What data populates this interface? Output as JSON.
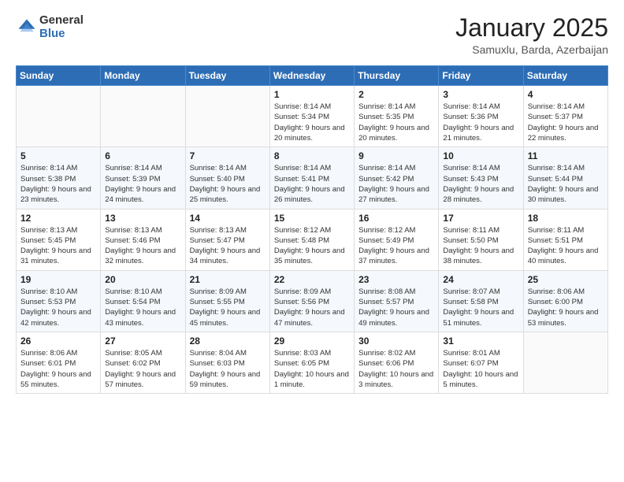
{
  "header": {
    "logo_line1": "General",
    "logo_line2": "Blue",
    "month": "January 2025",
    "location": "Samuxlu, Barda, Azerbaijan"
  },
  "weekdays": [
    "Sunday",
    "Monday",
    "Tuesday",
    "Wednesday",
    "Thursday",
    "Friday",
    "Saturday"
  ],
  "weeks": [
    [
      {
        "day": "",
        "sunrise": "",
        "sunset": "",
        "daylight": ""
      },
      {
        "day": "",
        "sunrise": "",
        "sunset": "",
        "daylight": ""
      },
      {
        "day": "",
        "sunrise": "",
        "sunset": "",
        "daylight": ""
      },
      {
        "day": "1",
        "sunrise": "Sunrise: 8:14 AM",
        "sunset": "Sunset: 5:34 PM",
        "daylight": "Daylight: 9 hours and 20 minutes."
      },
      {
        "day": "2",
        "sunrise": "Sunrise: 8:14 AM",
        "sunset": "Sunset: 5:35 PM",
        "daylight": "Daylight: 9 hours and 20 minutes."
      },
      {
        "day": "3",
        "sunrise": "Sunrise: 8:14 AM",
        "sunset": "Sunset: 5:36 PM",
        "daylight": "Daylight: 9 hours and 21 minutes."
      },
      {
        "day": "4",
        "sunrise": "Sunrise: 8:14 AM",
        "sunset": "Sunset: 5:37 PM",
        "daylight": "Daylight: 9 hours and 22 minutes."
      }
    ],
    [
      {
        "day": "5",
        "sunrise": "Sunrise: 8:14 AM",
        "sunset": "Sunset: 5:38 PM",
        "daylight": "Daylight: 9 hours and 23 minutes."
      },
      {
        "day": "6",
        "sunrise": "Sunrise: 8:14 AM",
        "sunset": "Sunset: 5:39 PM",
        "daylight": "Daylight: 9 hours and 24 minutes."
      },
      {
        "day": "7",
        "sunrise": "Sunrise: 8:14 AM",
        "sunset": "Sunset: 5:40 PM",
        "daylight": "Daylight: 9 hours and 25 minutes."
      },
      {
        "day": "8",
        "sunrise": "Sunrise: 8:14 AM",
        "sunset": "Sunset: 5:41 PM",
        "daylight": "Daylight: 9 hours and 26 minutes."
      },
      {
        "day": "9",
        "sunrise": "Sunrise: 8:14 AM",
        "sunset": "Sunset: 5:42 PM",
        "daylight": "Daylight: 9 hours and 27 minutes."
      },
      {
        "day": "10",
        "sunrise": "Sunrise: 8:14 AM",
        "sunset": "Sunset: 5:43 PM",
        "daylight": "Daylight: 9 hours and 28 minutes."
      },
      {
        "day": "11",
        "sunrise": "Sunrise: 8:14 AM",
        "sunset": "Sunset: 5:44 PM",
        "daylight": "Daylight: 9 hours and 30 minutes."
      }
    ],
    [
      {
        "day": "12",
        "sunrise": "Sunrise: 8:13 AM",
        "sunset": "Sunset: 5:45 PM",
        "daylight": "Daylight: 9 hours and 31 minutes."
      },
      {
        "day": "13",
        "sunrise": "Sunrise: 8:13 AM",
        "sunset": "Sunset: 5:46 PM",
        "daylight": "Daylight: 9 hours and 32 minutes."
      },
      {
        "day": "14",
        "sunrise": "Sunrise: 8:13 AM",
        "sunset": "Sunset: 5:47 PM",
        "daylight": "Daylight: 9 hours and 34 minutes."
      },
      {
        "day": "15",
        "sunrise": "Sunrise: 8:12 AM",
        "sunset": "Sunset: 5:48 PM",
        "daylight": "Daylight: 9 hours and 35 minutes."
      },
      {
        "day": "16",
        "sunrise": "Sunrise: 8:12 AM",
        "sunset": "Sunset: 5:49 PM",
        "daylight": "Daylight: 9 hours and 37 minutes."
      },
      {
        "day": "17",
        "sunrise": "Sunrise: 8:11 AM",
        "sunset": "Sunset: 5:50 PM",
        "daylight": "Daylight: 9 hours and 38 minutes."
      },
      {
        "day": "18",
        "sunrise": "Sunrise: 8:11 AM",
        "sunset": "Sunset: 5:51 PM",
        "daylight": "Daylight: 9 hours and 40 minutes."
      }
    ],
    [
      {
        "day": "19",
        "sunrise": "Sunrise: 8:10 AM",
        "sunset": "Sunset: 5:53 PM",
        "daylight": "Daylight: 9 hours and 42 minutes."
      },
      {
        "day": "20",
        "sunrise": "Sunrise: 8:10 AM",
        "sunset": "Sunset: 5:54 PM",
        "daylight": "Daylight: 9 hours and 43 minutes."
      },
      {
        "day": "21",
        "sunrise": "Sunrise: 8:09 AM",
        "sunset": "Sunset: 5:55 PM",
        "daylight": "Daylight: 9 hours and 45 minutes."
      },
      {
        "day": "22",
        "sunrise": "Sunrise: 8:09 AM",
        "sunset": "Sunset: 5:56 PM",
        "daylight": "Daylight: 9 hours and 47 minutes."
      },
      {
        "day": "23",
        "sunrise": "Sunrise: 8:08 AM",
        "sunset": "Sunset: 5:57 PM",
        "daylight": "Daylight: 9 hours and 49 minutes."
      },
      {
        "day": "24",
        "sunrise": "Sunrise: 8:07 AM",
        "sunset": "Sunset: 5:58 PM",
        "daylight": "Daylight: 9 hours and 51 minutes."
      },
      {
        "day": "25",
        "sunrise": "Sunrise: 8:06 AM",
        "sunset": "Sunset: 6:00 PM",
        "daylight": "Daylight: 9 hours and 53 minutes."
      }
    ],
    [
      {
        "day": "26",
        "sunrise": "Sunrise: 8:06 AM",
        "sunset": "Sunset: 6:01 PM",
        "daylight": "Daylight: 9 hours and 55 minutes."
      },
      {
        "day": "27",
        "sunrise": "Sunrise: 8:05 AM",
        "sunset": "Sunset: 6:02 PM",
        "daylight": "Daylight: 9 hours and 57 minutes."
      },
      {
        "day": "28",
        "sunrise": "Sunrise: 8:04 AM",
        "sunset": "Sunset: 6:03 PM",
        "daylight": "Daylight: 9 hours and 59 minutes."
      },
      {
        "day": "29",
        "sunrise": "Sunrise: 8:03 AM",
        "sunset": "Sunset: 6:05 PM",
        "daylight": "Daylight: 10 hours and 1 minute."
      },
      {
        "day": "30",
        "sunrise": "Sunrise: 8:02 AM",
        "sunset": "Sunset: 6:06 PM",
        "daylight": "Daylight: 10 hours and 3 minutes."
      },
      {
        "day": "31",
        "sunrise": "Sunrise: 8:01 AM",
        "sunset": "Sunset: 6:07 PM",
        "daylight": "Daylight: 10 hours and 5 minutes."
      },
      {
        "day": "",
        "sunrise": "",
        "sunset": "",
        "daylight": ""
      }
    ]
  ]
}
